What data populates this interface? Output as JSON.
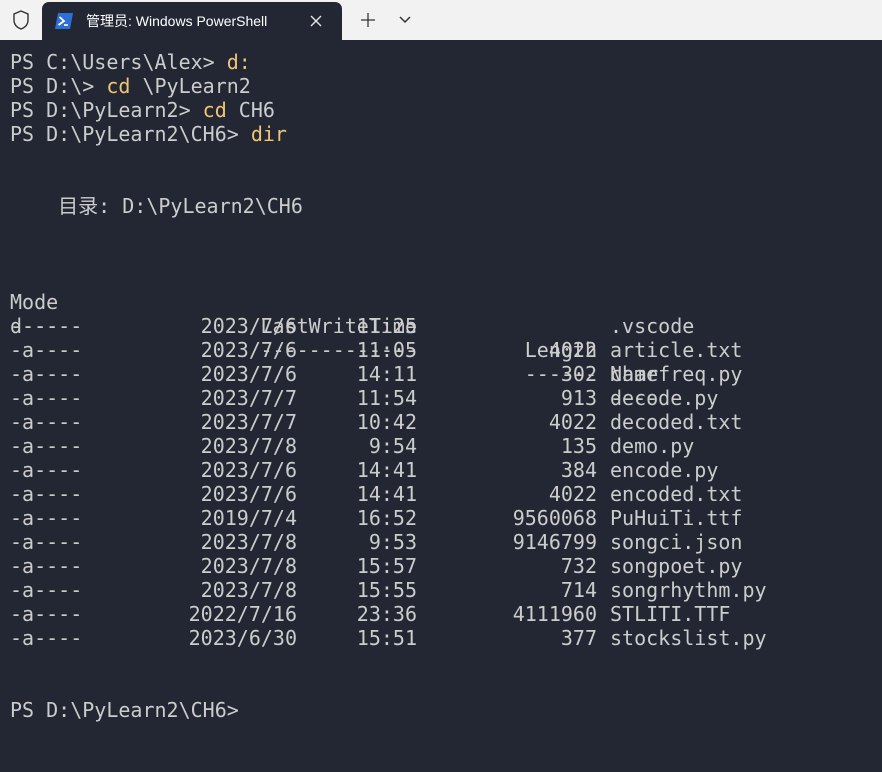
{
  "tab": {
    "title": "管理员: Windows PowerShell"
  },
  "icons": {
    "shield": "shield-icon",
    "powershell": "powershell-icon",
    "close": "close-icon",
    "new_tab": "plus-icon",
    "dropdown": "chevron-down-icon"
  },
  "colors": {
    "background": "#232733",
    "text": "#cccccc",
    "command": "#f0c674",
    "titlebar": "#f2f2f2"
  },
  "terminal": {
    "history": [
      {
        "prompt": "PS C:\\Users\\Alex> ",
        "command": "d:"
      },
      {
        "prompt": "PS D:\\> ",
        "command": "cd",
        "args": " \\PyLearn2"
      },
      {
        "prompt": "PS D:\\PyLearn2> ",
        "command": "cd",
        "args": " CH6"
      },
      {
        "prompt": "PS D:\\PyLearn2\\CH6> ",
        "command": "dir"
      }
    ],
    "directory_line": "    目录: D:\\PyLearn2\\CH6",
    "headers": {
      "mode": "Mode",
      "lastwritetime": "LastWriteTime",
      "length": "Length",
      "name": "Name"
    },
    "underlines": {
      "mode": "----",
      "lastwritetime": "-------------",
      "length": "------",
      "name": "----"
    },
    "rows": [
      {
        "mode": "d-----",
        "date": "2023/7/6",
        "time": "11:25",
        "length": "",
        "name": ".vscode"
      },
      {
        "mode": "-a----",
        "date": "2023/7/6",
        "time": "11:05",
        "length": "4022",
        "name": "article.txt"
      },
      {
        "mode": "-a----",
        "date": "2023/7/6",
        "time": "14:11",
        "length": "302",
        "name": "charfreq.py"
      },
      {
        "mode": "-a----",
        "date": "2023/7/7",
        "time": "11:54",
        "length": "913",
        "name": "decode.py"
      },
      {
        "mode": "-a----",
        "date": "2023/7/7",
        "time": "10:42",
        "length": "4022",
        "name": "decoded.txt"
      },
      {
        "mode": "-a----",
        "date": "2023/7/8",
        "time": "9:54",
        "length": "135",
        "name": "demo.py"
      },
      {
        "mode": "-a----",
        "date": "2023/7/6",
        "time": "14:41",
        "length": "384",
        "name": "encode.py"
      },
      {
        "mode": "-a----",
        "date": "2023/7/6",
        "time": "14:41",
        "length": "4022",
        "name": "encoded.txt"
      },
      {
        "mode": "-a----",
        "date": "2019/7/4",
        "time": "16:52",
        "length": "9560068",
        "name": "PuHuiTi.ttf"
      },
      {
        "mode": "-a----",
        "date": "2023/7/8",
        "time": "9:53",
        "length": "9146799",
        "name": "songci.json"
      },
      {
        "mode": "-a----",
        "date": "2023/7/8",
        "time": "15:57",
        "length": "732",
        "name": "songpoet.py"
      },
      {
        "mode": "-a----",
        "date": "2023/7/8",
        "time": "15:55",
        "length": "714",
        "name": "songrhythm.py"
      },
      {
        "mode": "-a----",
        "date": "2022/7/16",
        "time": "23:36",
        "length": "4111960",
        "name": "STLITI.TTF"
      },
      {
        "mode": "-a----",
        "date": "2023/6/30",
        "time": "15:51",
        "length": "377",
        "name": "stockslist.py"
      }
    ],
    "final_prompt": "PS D:\\PyLearn2\\CH6> "
  }
}
